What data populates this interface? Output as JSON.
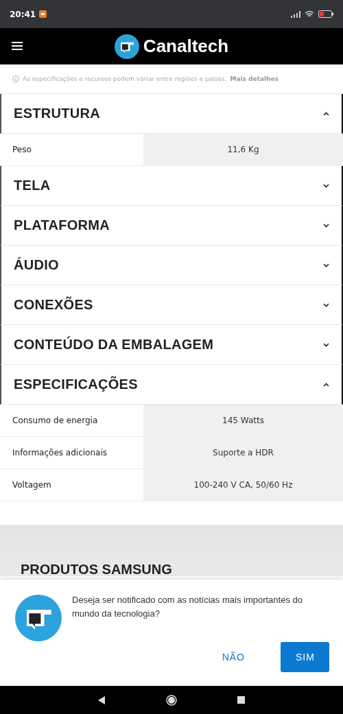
{
  "status_bar": {
    "time": "20:41"
  },
  "header": {
    "logo_text": "Canaltech"
  },
  "note": {
    "text": "As especificações e recursos podem variar entre regiões e países.",
    "link": "Mais detalhes"
  },
  "sections": [
    {
      "title": "ESTRUTURA",
      "expanded": true,
      "rows": [
        {
          "label": "Peso",
          "value": "11,6 Kg"
        }
      ]
    },
    {
      "title": "TELA",
      "expanded": false
    },
    {
      "title": "PLATAFORMA",
      "expanded": false
    },
    {
      "title": "ÁUDIO",
      "expanded": false
    },
    {
      "title": "CONEXÕES",
      "expanded": false
    },
    {
      "title": "CONTEÚDO DA EMBALAGEM",
      "expanded": false
    },
    {
      "title": "ESPECIFICAÇÕES",
      "expanded": true,
      "rows": [
        {
          "label": "Consumo de energia",
          "value": "145 Watts"
        },
        {
          "label": "Informações adicionais",
          "value": "Suporte a HDR"
        },
        {
          "label": "Voltagem",
          "value": "100-240 V CA, 50/60 Hz"
        }
      ]
    }
  ],
  "products": {
    "title": "PRODUTOS SAMSUNG"
  },
  "dialog": {
    "message": "Deseja ser notificado com as notícias mais importantes do mundo da tecnologia?",
    "buttons": [
      {
        "label": "NÃO",
        "kind": "text"
      },
      {
        "label": "SIM",
        "kind": "primary"
      }
    ]
  }
}
